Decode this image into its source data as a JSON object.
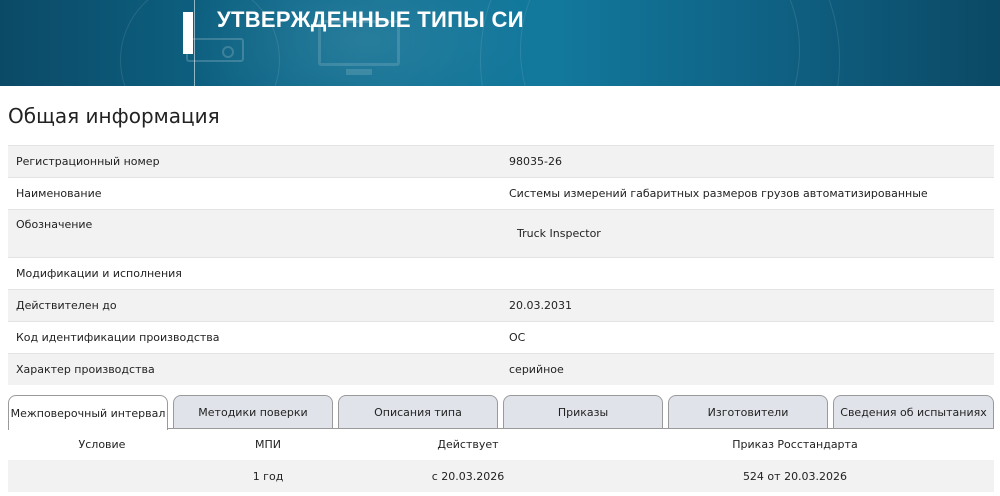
{
  "banner": {
    "title": "УТВЕРЖДЕННЫЕ ТИПЫ СИ"
  },
  "section": {
    "title": "Общая информация"
  },
  "info": {
    "rows": [
      {
        "label": "Регистрационный номер",
        "value": "98035-26"
      },
      {
        "label": "Наименование",
        "value": "Системы измерений габаритных размеров грузов автоматизированные"
      },
      {
        "label": "Обозначение",
        "value": "Truck Inspector"
      },
      {
        "label": "Модификации и исполнения",
        "value": ""
      },
      {
        "label": "Действителен до",
        "value": "20.03.2031"
      },
      {
        "label": "Код идентификации производства",
        "value": "ОС"
      },
      {
        "label": "Характер производства",
        "value": "серийное"
      }
    ]
  },
  "tabs": [
    {
      "label": "Межповерочный интервал",
      "active": true
    },
    {
      "label": "Методики поверки",
      "active": false
    },
    {
      "label": "Описания типа",
      "active": false
    },
    {
      "label": "Приказы",
      "active": false
    },
    {
      "label": "Изготовители",
      "active": false
    },
    {
      "label": "Сведения об испытаниях",
      "active": false
    }
  ],
  "mpi_table": {
    "headers": [
      "Условие",
      "МПИ",
      "Действует",
      "Приказ Росстандарта"
    ],
    "rows": [
      [
        "",
        "1 год",
        "с 20.03.2026",
        "524 от 20.03.2026"
      ]
    ]
  }
}
